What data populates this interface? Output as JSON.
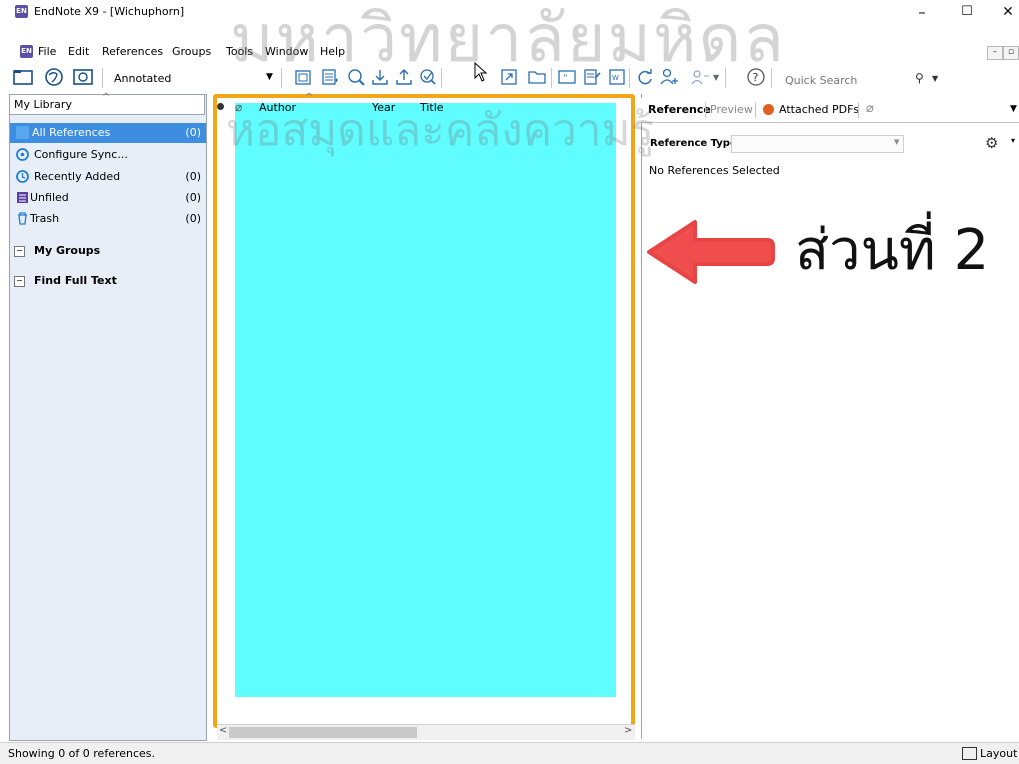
{
  "window": {
    "app_icon": "EN",
    "title": "EndNote X9 - [Wichuphorn]",
    "minimize": "–",
    "maximize": "☐",
    "close": "✕"
  },
  "menubar": {
    "items": [
      "File",
      "Edit",
      "References",
      "Groups",
      "Tools",
      "Window",
      "Help"
    ]
  },
  "toolbar": {
    "style_value": "Annotated",
    "quick_search_placeholder": "Quick Search"
  },
  "left_panel": {
    "library_label": "My Library",
    "items": [
      {
        "label": "All References",
        "count": "(0)",
        "icon": "library-icon",
        "selected": true
      },
      {
        "label": "Configure Sync...",
        "count": "",
        "icon": "sync-icon"
      },
      {
        "label": "Recently Added",
        "count": "(0)",
        "icon": "clock-icon"
      },
      {
        "label": "Unfiled",
        "count": "(0)",
        "icon": "unfiled-icon"
      },
      {
        "label": "Trash",
        "count": "(0)",
        "icon": "trash-icon"
      }
    ],
    "sections": [
      {
        "label": "My Groups",
        "icon": "collapse-icon"
      },
      {
        "label": "Find Full Text",
        "icon": "collapse-icon"
      }
    ]
  },
  "center_panel": {
    "columns": [
      "Author",
      "Year",
      "Title"
    ]
  },
  "right_panel": {
    "tabs": [
      "Reference",
      "Preview",
      "Attached PDFs"
    ],
    "reference_type_label": "Reference Type:",
    "empty_message": "No References Selected"
  },
  "annotation": {
    "text": "ส่วนที่ 2",
    "arrow_color": "#f04e4e",
    "highlight_color": "#f2a516",
    "fill_color": "#5ffdff"
  },
  "watermark": {
    "line1": "มหาวิทยาลัยมหิดล",
    "line2": "หอสมุดและคลังความรู้"
  },
  "status_bar": {
    "text": "Showing 0 of 0 references.",
    "layout_label": "Layout"
  }
}
